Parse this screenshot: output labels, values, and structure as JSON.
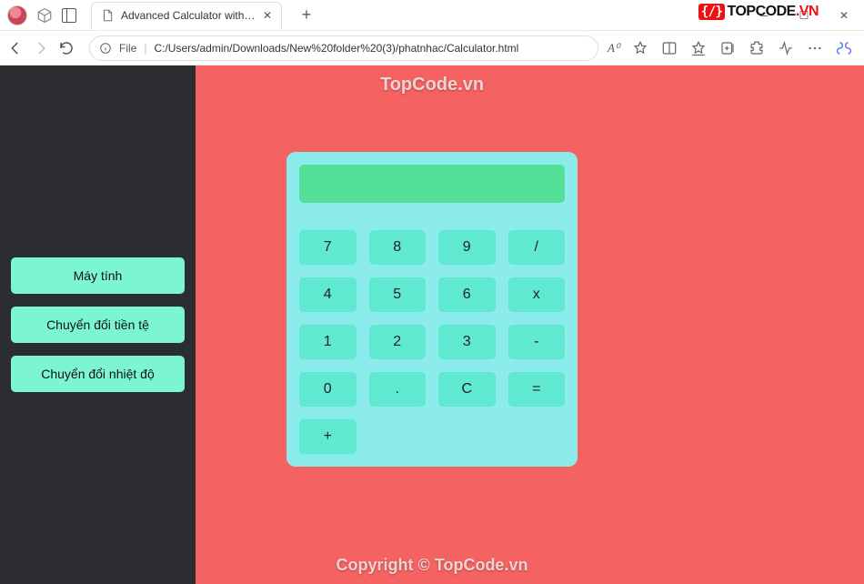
{
  "browser": {
    "tab_title": "Advanced Calculator with Curren",
    "address_prefix": "File",
    "address_path": "C:/Users/admin/Downloads/New%20folder%20(3)/phatnhac/Calculator.html",
    "read_aloud": "A⁰"
  },
  "watermark": {
    "top": "TopCode.vn",
    "bottom": "Copyright © TopCode.vn"
  },
  "logo": {
    "mark": "{/}",
    "top": "TOP",
    "code": "CODE",
    "vn": ".VN"
  },
  "sidebar": {
    "items": [
      {
        "label": "Máy tính"
      },
      {
        "label": "Chuyển đổi tiền tệ"
      },
      {
        "label": "Chuyển đổi nhiệt độ"
      }
    ]
  },
  "calculator": {
    "display": "",
    "keys": [
      "7",
      "8",
      "9",
      "/",
      "4",
      "5",
      "6",
      "x",
      "1",
      "2",
      "3",
      "-",
      "0",
      ".",
      "C",
      "=",
      "+"
    ]
  }
}
